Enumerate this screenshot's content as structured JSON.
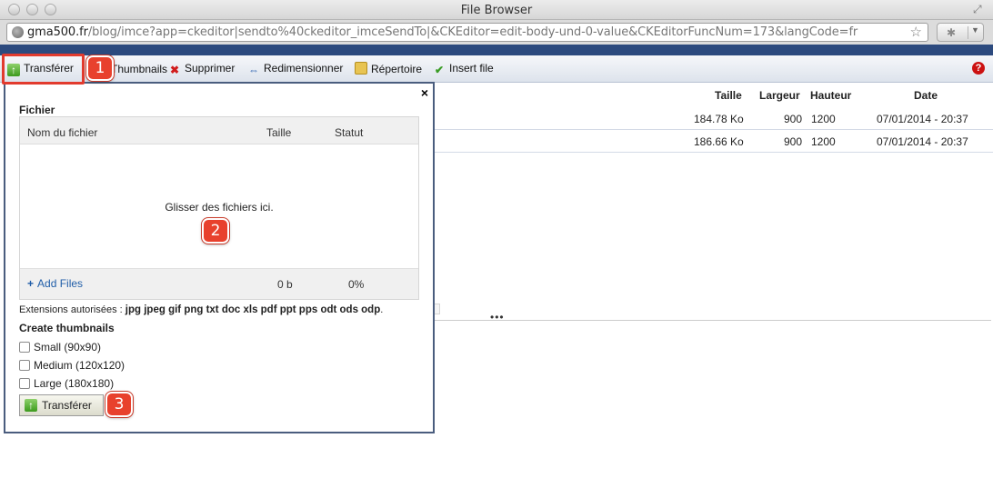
{
  "window": {
    "title": "File Browser"
  },
  "address_bar": {
    "host": "gma500.fr",
    "path": "/blog/imce?app=ckeditor|sendto%40ckeditor_imceSendTo|&CKEditor=edit-body-und-0-value&CKEditorFuncNum=173&langCode=fr"
  },
  "toolbar": {
    "upload": "Transférer",
    "thumbnails": "Thumbnails",
    "delete": "Supprimer",
    "resize": "Redimensionner",
    "directory": "Répertoire",
    "insert": "Insert file"
  },
  "file_table": {
    "columns": [
      "Taille",
      "Largeur",
      "Hauteur",
      "Date"
    ],
    "rows": [
      {
        "size": "184.78 Ko",
        "width": "900",
        "height": "1200",
        "date": "07/01/2014 - 20:37"
      },
      {
        "size": "186.66 Ko",
        "width": "900",
        "height": "1200",
        "date": "07/01/2014 - 20:37"
      }
    ]
  },
  "upload_panel": {
    "close": "×",
    "section_label": "Fichier",
    "columns": {
      "name": "Nom du fichier",
      "size": "Taille",
      "status": "Statut"
    },
    "drop_message": "Glisser des fichiers ici.",
    "add_files": "Add Files",
    "total_size": "0 b",
    "total_percent": "0%",
    "extensions_label": "Extensions autorisées :",
    "extensions": "jpg jpeg gif png txt doc xls pdf ppt pps odt ods odp",
    "thumbnails_label": "Create thumbnails",
    "thumbnail_options": [
      "Small (90x90)",
      "Medium (120x120)",
      "Large (180x180)"
    ],
    "submit": "Transférer"
  },
  "annotations": [
    "1",
    "2",
    "3"
  ],
  "colors": {
    "annotation": "#e8412d",
    "header_bar": "#2c4a7e",
    "link": "#1f5da8"
  }
}
